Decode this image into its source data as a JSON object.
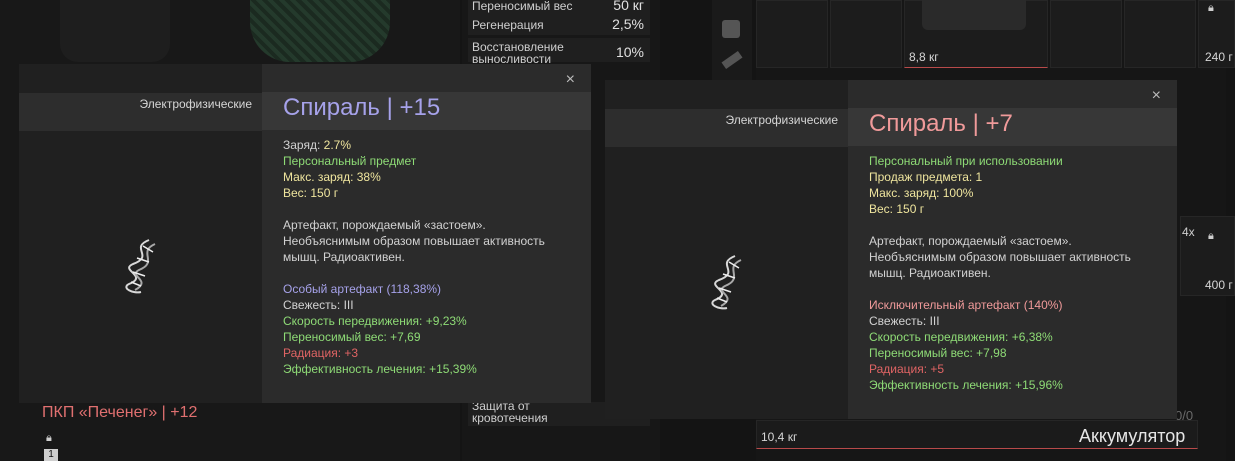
{
  "background": {
    "stats": [
      {
        "label": "Переносимый вес",
        "value": "50 кг"
      },
      {
        "label": "Регенерация",
        "value": "2,5%"
      },
      {
        "label": "Восстановление выносливости",
        "value": "10%"
      }
    ],
    "bottom_stat_label": "Защита от кровотечения",
    "weapon_name": "ПКП «Печенег» | +12",
    "weapon_count": "1",
    "slot_weight_top": "8,8 кг",
    "slot_weight_bottom": "10,4 кг",
    "slot_weight_right_top": "240 г",
    "slot_weight_right_mid": "400 г",
    "slot_multiplier": "4x",
    "slot_item_name": "Аккумулятор",
    "slot_fraction": "0/0"
  },
  "tooltip_1": {
    "category": "Электрофизические",
    "title_name": "Спираль",
    "title_sep": " | ",
    "title_level": "+15",
    "close": "×",
    "charge_label": "Заряд:",
    "charge_value": "2.7%",
    "personal": "Персональный предмет",
    "max_charge": "Макс. заряд: 38%",
    "weight": "Вес: 150 г",
    "description": [
      "Артефакт, порождаемый «застоем».",
      "Необъяснимым образом повышает активность",
      "мышц. Радиоактивен."
    ],
    "rarity": "Особый артефакт (118,38%)",
    "freshness": "Свежесть: III",
    "speed": "Скорость передвижения: +9,23%",
    "carry": "Переносимый вес: +7,69",
    "radiation": "Радиация: +3",
    "healing": "Эффективность лечения: +15,39%",
    "colors": {
      "title": "#a6a2ea",
      "rarity": "#a6a2ea"
    }
  },
  "tooltip_2": {
    "category": "Электрофизические",
    "title_name": "Спираль",
    "title_sep": " | ",
    "title_level": "+7",
    "close": "×",
    "personal": "Персональный при использовании",
    "sales": "Продаж предмета: 1",
    "max_charge": "Макс. заряд: 100%",
    "weight": "Вес: 150 г",
    "description": [
      "Артефакт, порождаемый «застоем».",
      "Необъяснимым образом повышает активность",
      "мышц. Радиоактивен."
    ],
    "rarity": "Исключительный артефакт (140%)",
    "freshness": "Свежесть: III",
    "speed": "Скорость передвижения: +6,38%",
    "carry": "Переносимый вес: +7,98",
    "radiation": "Радиация: +5",
    "healing": "Эффективность лечения: +15,96%",
    "colors": {
      "title": "#f09a9a",
      "rarity": "#f09a9a"
    }
  }
}
